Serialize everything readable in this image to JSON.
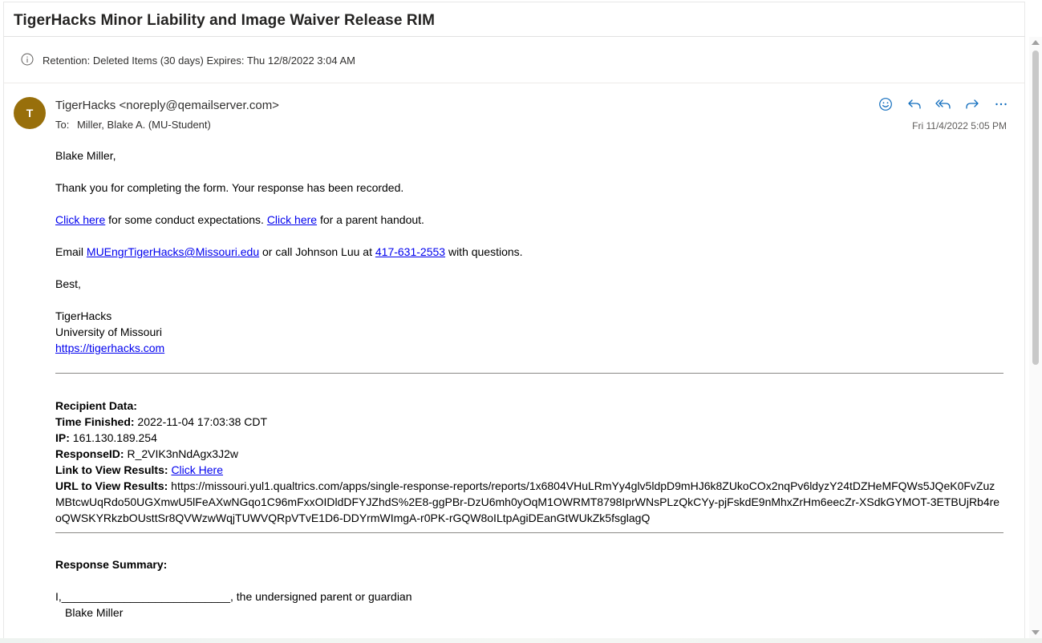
{
  "message": {
    "subject": "TigerHacks Minor Liability and Image Waiver Release RIM",
    "retention": "Retention: Deleted Items (30 days) Expires: Thu 12/8/2022 3:04 AM",
    "avatar_initial": "T",
    "avatar_color": "#986f0b",
    "sender": "TigerHacks <noreply@qemailserver.com>",
    "to_label": "To:",
    "to_value": "Miller, Blake A. (MU-Student)",
    "date": "Fri 11/4/2022 5:05 PM"
  },
  "actions": [
    {
      "name": "emoji-react",
      "icon": "smile-icon"
    },
    {
      "name": "reply",
      "icon": "reply-icon"
    },
    {
      "name": "reply-all",
      "icon": "reply-all-icon"
    },
    {
      "name": "forward",
      "icon": "forward-icon"
    },
    {
      "name": "more",
      "icon": "more-icon"
    }
  ],
  "body": {
    "greeting": "Blake Miller,",
    "thanks": "Thank you for completing the form. Your response has been recorded.",
    "link1": "Click here",
    "mid1": " for some conduct expectations. ",
    "link2": "Click here",
    "mid2": " for a parent handout.",
    "email_prefix": "Email ",
    "email_link": "MUEngrTigerHacks@Missouri.edu",
    "email_mid": " or call Johnson Luu at ",
    "phone_link": "417-631-2553",
    "email_suffix": " with questions.",
    "closing": "Best,",
    "sig_name": "TigerHacks",
    "sig_org": "University of Missouri",
    "sig_url": "https://tigerhacks.com"
  },
  "recipient": {
    "heading": "Recipient Data:",
    "time_label": "Time Finished:",
    "time_value": " 2022-11-04 17:03:38 CDT",
    "ip_label": "IP:",
    "ip_value": " 161.130.189.254",
    "rid_label": "ResponseID:",
    "rid_value": " R_2VIK3nNdAgx3J2w",
    "link_label": "Link to View Results:",
    "link_value": "Click Here",
    "url_label": "URL to View Results:",
    "url_value": " https://missouri.yul1.qualtrics.com/apps/single-response-reports/reports/1x6804VHuLRmYy4glv5ldpD9mHJ6k8ZUkoCOx2nqPv6ldyzY24tDZHeMFQWs5JQeK0FvZuzMBtcwUqRdo50UGXmwU5lFeAXwNGqo1C96mFxxOIDldDFYJZhdS%2E8-ggPBr-DzU6mh0yOqM1OWRMT8798IprWNsPLzQkCYy-pjFskdE9nMhxZrHm6eecZr-XSdkGYMOT-3ETBUjRb4reoQWSKYRkzbOUsttSr8QVWzwWqjTUWVQRpVTvE1D6-DDYrmWImgA-r0PK-rGQW8oILtpAgiDEanGtWUkZk5fsglagQ"
  },
  "summary": {
    "heading": "Response Summary:",
    "line1": "I,___________________________, the undersigned parent or guardian",
    "name": "Blake Miller"
  }
}
